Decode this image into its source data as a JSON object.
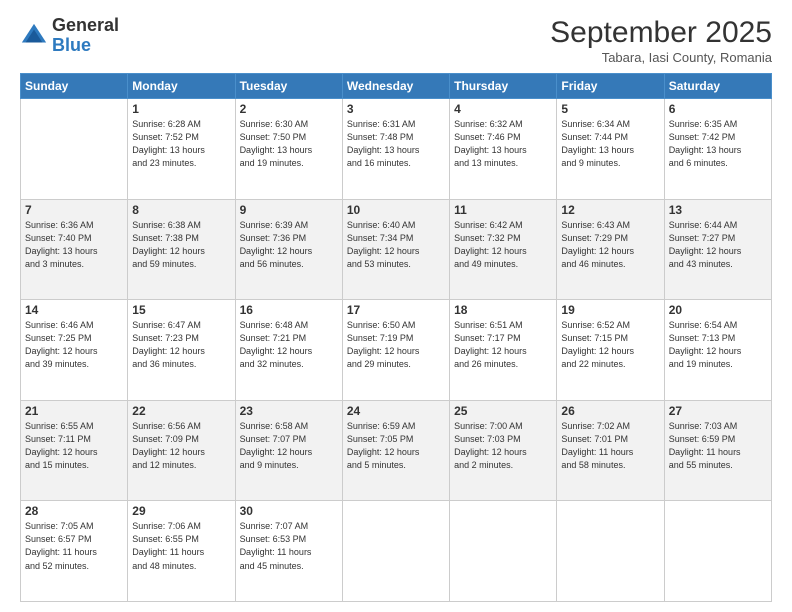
{
  "logo": {
    "general": "General",
    "blue": "Blue"
  },
  "header": {
    "month": "September 2025",
    "location": "Tabara, Iasi County, Romania"
  },
  "days_of_week": [
    "Sunday",
    "Monday",
    "Tuesday",
    "Wednesday",
    "Thursday",
    "Friday",
    "Saturday"
  ],
  "weeks": [
    [
      {
        "day": "",
        "info": ""
      },
      {
        "day": "1",
        "info": "Sunrise: 6:28 AM\nSunset: 7:52 PM\nDaylight: 13 hours\nand 23 minutes."
      },
      {
        "day": "2",
        "info": "Sunrise: 6:30 AM\nSunset: 7:50 PM\nDaylight: 13 hours\nand 19 minutes."
      },
      {
        "day": "3",
        "info": "Sunrise: 6:31 AM\nSunset: 7:48 PM\nDaylight: 13 hours\nand 16 minutes."
      },
      {
        "day": "4",
        "info": "Sunrise: 6:32 AM\nSunset: 7:46 PM\nDaylight: 13 hours\nand 13 minutes."
      },
      {
        "day": "5",
        "info": "Sunrise: 6:34 AM\nSunset: 7:44 PM\nDaylight: 13 hours\nand 9 minutes."
      },
      {
        "day": "6",
        "info": "Sunrise: 6:35 AM\nSunset: 7:42 PM\nDaylight: 13 hours\nand 6 minutes."
      }
    ],
    [
      {
        "day": "7",
        "info": "Sunrise: 6:36 AM\nSunset: 7:40 PM\nDaylight: 13 hours\nand 3 minutes."
      },
      {
        "day": "8",
        "info": "Sunrise: 6:38 AM\nSunset: 7:38 PM\nDaylight: 12 hours\nand 59 minutes."
      },
      {
        "day": "9",
        "info": "Sunrise: 6:39 AM\nSunset: 7:36 PM\nDaylight: 12 hours\nand 56 minutes."
      },
      {
        "day": "10",
        "info": "Sunrise: 6:40 AM\nSunset: 7:34 PM\nDaylight: 12 hours\nand 53 minutes."
      },
      {
        "day": "11",
        "info": "Sunrise: 6:42 AM\nSunset: 7:32 PM\nDaylight: 12 hours\nand 49 minutes."
      },
      {
        "day": "12",
        "info": "Sunrise: 6:43 AM\nSunset: 7:29 PM\nDaylight: 12 hours\nand 46 minutes."
      },
      {
        "day": "13",
        "info": "Sunrise: 6:44 AM\nSunset: 7:27 PM\nDaylight: 12 hours\nand 43 minutes."
      }
    ],
    [
      {
        "day": "14",
        "info": "Sunrise: 6:46 AM\nSunset: 7:25 PM\nDaylight: 12 hours\nand 39 minutes."
      },
      {
        "day": "15",
        "info": "Sunrise: 6:47 AM\nSunset: 7:23 PM\nDaylight: 12 hours\nand 36 minutes."
      },
      {
        "day": "16",
        "info": "Sunrise: 6:48 AM\nSunset: 7:21 PM\nDaylight: 12 hours\nand 32 minutes."
      },
      {
        "day": "17",
        "info": "Sunrise: 6:50 AM\nSunset: 7:19 PM\nDaylight: 12 hours\nand 29 minutes."
      },
      {
        "day": "18",
        "info": "Sunrise: 6:51 AM\nSunset: 7:17 PM\nDaylight: 12 hours\nand 26 minutes."
      },
      {
        "day": "19",
        "info": "Sunrise: 6:52 AM\nSunset: 7:15 PM\nDaylight: 12 hours\nand 22 minutes."
      },
      {
        "day": "20",
        "info": "Sunrise: 6:54 AM\nSunset: 7:13 PM\nDaylight: 12 hours\nand 19 minutes."
      }
    ],
    [
      {
        "day": "21",
        "info": "Sunrise: 6:55 AM\nSunset: 7:11 PM\nDaylight: 12 hours\nand 15 minutes."
      },
      {
        "day": "22",
        "info": "Sunrise: 6:56 AM\nSunset: 7:09 PM\nDaylight: 12 hours\nand 12 minutes."
      },
      {
        "day": "23",
        "info": "Sunrise: 6:58 AM\nSunset: 7:07 PM\nDaylight: 12 hours\nand 9 minutes."
      },
      {
        "day": "24",
        "info": "Sunrise: 6:59 AM\nSunset: 7:05 PM\nDaylight: 12 hours\nand 5 minutes."
      },
      {
        "day": "25",
        "info": "Sunrise: 7:00 AM\nSunset: 7:03 PM\nDaylight: 12 hours\nand 2 minutes."
      },
      {
        "day": "26",
        "info": "Sunrise: 7:02 AM\nSunset: 7:01 PM\nDaylight: 11 hours\nand 58 minutes."
      },
      {
        "day": "27",
        "info": "Sunrise: 7:03 AM\nSunset: 6:59 PM\nDaylight: 11 hours\nand 55 minutes."
      }
    ],
    [
      {
        "day": "28",
        "info": "Sunrise: 7:05 AM\nSunset: 6:57 PM\nDaylight: 11 hours\nand 52 minutes."
      },
      {
        "day": "29",
        "info": "Sunrise: 7:06 AM\nSunset: 6:55 PM\nDaylight: 11 hours\nand 48 minutes."
      },
      {
        "day": "30",
        "info": "Sunrise: 7:07 AM\nSunset: 6:53 PM\nDaylight: 11 hours\nand 45 minutes."
      },
      {
        "day": "",
        "info": ""
      },
      {
        "day": "",
        "info": ""
      },
      {
        "day": "",
        "info": ""
      },
      {
        "day": "",
        "info": ""
      }
    ]
  ]
}
